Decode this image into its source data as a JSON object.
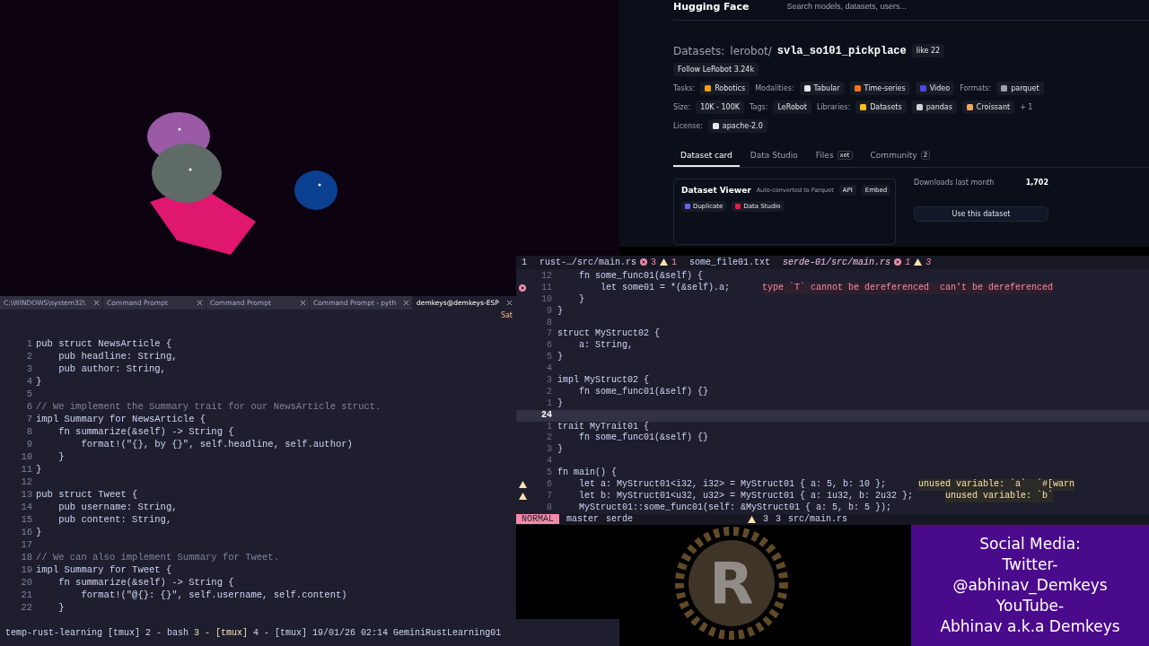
{
  "hf": {
    "brand": "Hugging Face",
    "search_placeholder": "Search models, datasets, users...",
    "dataset": {
      "prefix": "Datasets:",
      "owner": "lerobot/",
      "name": "svla_so101_pickplace",
      "like_label": "like",
      "like_count": "22"
    },
    "follow": {
      "label": "Follow",
      "org": "LeRobot",
      "count": "3.24k"
    },
    "meta_rows": [
      {
        "items": [
          {
            "kind": "label",
            "text": "Tasks:"
          },
          {
            "kind": "chip",
            "text": "Robotics",
            "color": "#f59e0b"
          },
          {
            "kind": "label",
            "text": "Modalities:"
          },
          {
            "kind": "chip",
            "text": "Tabular",
            "color": "#e5e7eb"
          },
          {
            "kind": "chip",
            "text": "Time-series",
            "color": "#f97316"
          },
          {
            "kind": "chip",
            "text": "Video",
            "color": "#4f46e5"
          },
          {
            "kind": "label",
            "text": "Formats:"
          },
          {
            "kind": "chip",
            "text": "parquet",
            "color": "#9ca3af"
          }
        ]
      },
      {
        "items": [
          {
            "kind": "label",
            "text": "Size:"
          },
          {
            "kind": "chip",
            "text": "10K - 100K"
          },
          {
            "kind": "label",
            "text": "Tags:"
          },
          {
            "kind": "chip",
            "text": "LeRobot"
          },
          {
            "kind": "label",
            "text": "Libraries:"
          },
          {
            "kind": "chip",
            "text": "Datasets",
            "color": "#fbbf24"
          },
          {
            "kind": "chip",
            "text": "pandas",
            "color": "#d1d5db"
          },
          {
            "kind": "chip",
            "text": "Croissant",
            "color": "#f4a261"
          },
          {
            "kind": "more",
            "text": "+ 1"
          }
        ]
      },
      {
        "items": [
          {
            "kind": "label",
            "text": "License:"
          },
          {
            "kind": "chip",
            "text": "apache-2.0",
            "color": "#e5e7eb"
          }
        ]
      }
    ],
    "tabs": [
      {
        "label": "Dataset card",
        "selected": true
      },
      {
        "label": "Data Studio",
        "selected": false
      },
      {
        "label": "Files",
        "badge": "xet",
        "selected": false
      },
      {
        "label": "Community",
        "badge": "2",
        "selected": false
      }
    ],
    "viewer": {
      "title": "Dataset Viewer",
      "note": "Auto-converted to Parquet",
      "buttons": [
        "API",
        "Embed"
      ],
      "actions": [
        {
          "label": "Duplicate",
          "color": "#6366f1"
        },
        {
          "label": "Data Studio",
          "color": "#e11d48"
        }
      ]
    },
    "downloads": {
      "label": "Downloads last month",
      "value": "1,702"
    },
    "use_button": "Use this dataset"
  },
  "terminal": {
    "tabs": [
      {
        "label": "C:\\WINDOWS\\system32\\",
        "selected": false
      },
      {
        "label": "Command Prompt",
        "selected": false
      },
      {
        "label": "Command Prompt",
        "selected": false
      },
      {
        "label": "Command Prompt - pyth",
        "selected": false
      },
      {
        "label": "demkeys@demkeys-ESP",
        "selected": true
      }
    ],
    "clock": "Sat",
    "lines": [
      {
        "n": "1",
        "code": "pub struct NewsArticle {",
        "kind": "code"
      },
      {
        "n": "2",
        "code": "    pub headline: String,",
        "kind": "code"
      },
      {
        "n": "3",
        "code": "    pub author: String,",
        "kind": "code"
      },
      {
        "n": "4",
        "code": "}",
        "kind": "code"
      },
      {
        "n": "5"
      },
      {
        "n": "6",
        "code": "// We implement the Summary trait for our NewsArticle struct.",
        "kind": "comment"
      },
      {
        "n": "7",
        "code": "impl Summary for NewsArticle {",
        "kind": "code"
      },
      {
        "n": "8",
        "code": "    fn summarize(&self) -> String {",
        "kind": "code"
      },
      {
        "n": "9",
        "code": "        format!(\"{}, by {}\", self.headline, self.author)",
        "kind": "code"
      },
      {
        "n": "10",
        "code": "    }",
        "kind": "code"
      },
      {
        "n": "11",
        "code": "}",
        "kind": "code"
      },
      {
        "n": "12"
      },
      {
        "n": "13",
        "code": "pub struct Tweet {",
        "kind": "code"
      },
      {
        "n": "14",
        "code": "    pub username: String,",
        "kind": "code"
      },
      {
        "n": "15",
        "code": "    pub content: String,",
        "kind": "code"
      },
      {
        "n": "16",
        "code": "}",
        "kind": "code"
      },
      {
        "n": "17"
      },
      {
        "n": "18",
        "code": "// We can also implement Summary for Tweet.",
        "kind": "comment"
      },
      {
        "n": "19",
        "code": "impl Summary for Tweet {",
        "kind": "code"
      },
      {
        "n": "20",
        "code": "    fn summarize(&self) -> String {",
        "kind": "code"
      },
      {
        "n": "21",
        "code": "        format!(\"@{}: {}\", self.username, self.content)",
        "kind": "code"
      },
      {
        "n": "22",
        "code": "    }",
        "kind": "code"
      }
    ]
  },
  "editor": {
    "buffer_number": "1",
    "tabs": [
      {
        "label": "rust-…/src/main.rs",
        "errors": "3",
        "warnings": "1",
        "selected": false
      },
      {
        "label": "some_file01.txt",
        "selected": false
      },
      {
        "label": "serde-01/src/main.rs",
        "errors": "1",
        "warnings": "3",
        "selected": true
      }
    ],
    "lines": [
      {
        "n": "12",
        "code": "    fn some_func01(&self) {",
        "current": false
      },
      {
        "n": "11",
        "code": "        let some01 = *(&self).a;",
        "current": false,
        "diag": {
          "kind": "error",
          "text": "type `T` cannot be dereferenced  can't be dereferenced"
        }
      },
      {
        "n": "10",
        "code": "    }",
        "current": false
      },
      {
        "n": "9",
        "code": "}",
        "current": false
      },
      {
        "n": "8",
        "current": false
      },
      {
        "n": "7",
        "code": "struct MyStruct02 {",
        "current": false
      },
      {
        "n": "6",
        "code": "    a: String,",
        "current": false
      },
      {
        "n": "5",
        "code": "}",
        "current": false
      },
      {
        "n": "4",
        "current": false
      },
      {
        "n": "3",
        "code": "impl MyStruct02 {",
        "current": false
      },
      {
        "n": "2",
        "code": "    fn some_func01(&self) {}",
        "current": false
      },
      {
        "n": "1",
        "code": "}",
        "current": false
      },
      {
        "n": "24",
        "current": true
      },
      {
        "n": "1",
        "code": "trait MyTrait01 {",
        "current": false
      },
      {
        "n": "2",
        "code": "    fn some_func01(&self) {}",
        "current": false
      },
      {
        "n": "3",
        "code": "}",
        "current": false
      },
      {
        "n": "4",
        "current": false
      },
      {
        "n": "5",
        "code": "fn main() {",
        "current": false
      },
      {
        "n": "6",
        "code": "    let a: MyStruct01<i32, i32> = MyStruct01 { a: 5, b: 10 };",
        "current": false,
        "diag": {
          "kind": "warning",
          "text": "unused variable: `a`  `#[warn"
        }
      },
      {
        "n": "7",
        "code": "    let b: MyStruct01<u32, u32> = MyStruct01 { a: 1u32, b: 2u32 };",
        "current": false,
        "diag": {
          "kind": "warning",
          "text": "unused variable: `b`"
        }
      },
      {
        "n": "8",
        "code": "    MyStruct01::some_func01(self: &MyStruct01 { a: 5, b: 5 });",
        "current": false
      }
    ],
    "status": {
      "mode": "NORMAL",
      "branch": "master",
      "dir": "serde",
      "warnings": "3",
      "hints": "3",
      "file": "src/main.rs"
    }
  },
  "overlay": {
    "logo_letter": "R"
  },
  "social": {
    "lines": [
      "Social Media:",
      "Twitter-",
      "@abhinav_Demkeys",
      "YouTube-",
      "Abhinav a.k.a Demkeys"
    ]
  },
  "tmux": {
    "session": "temp-rust-learning",
    "windows": [
      {
        "label": "[tmux]",
        "selected": false
      },
      {
        "label": "2 - bash",
        "selected": false
      },
      {
        "label": "3 - [tmux]",
        "selected": true
      },
      {
        "label": "4 - [tmux]",
        "selected": false
      }
    ],
    "datetime": "19/01/26 02:14",
    "right": "GeminiRustLearning01"
  }
}
